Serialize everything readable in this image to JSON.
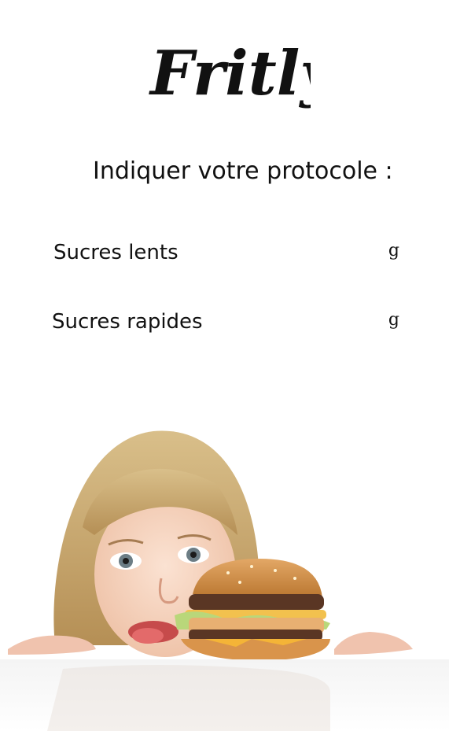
{
  "logo": {
    "text": "Fritly"
  },
  "protocol": {
    "title": "Indiquer votre protocole :",
    "fields": [
      {
        "label": "Sucres lents",
        "unit": "g",
        "value": ""
      },
      {
        "label": "Sucres rapides",
        "unit": "g",
        "value": ""
      }
    ]
  },
  "illustration": {
    "subject": "girl-licking-lips-at-burger"
  },
  "colors": {
    "background": "#ffffff",
    "text": "#111111"
  }
}
